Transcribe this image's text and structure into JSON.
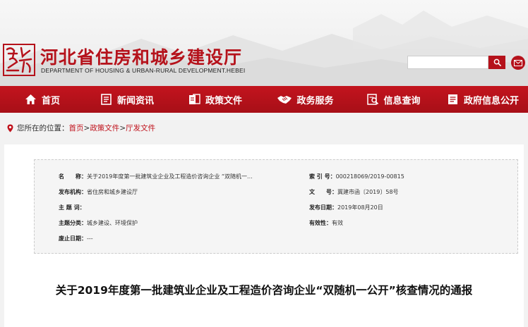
{
  "header": {
    "site_title": "河北省住房和城乡建设厅",
    "site_subtitle": "DEPARTMENT OF HOUSING & URBAN-RURAL DEVELOPMENT.HEBEI",
    "search_value": "",
    "logo_text": "建设厅"
  },
  "nav": {
    "items": [
      {
        "label": "首页",
        "icon": "home-icon"
      },
      {
        "label": "新闻资讯",
        "icon": "news-icon"
      },
      {
        "label": "政策文件",
        "icon": "policy-icon"
      },
      {
        "label": "政务服务",
        "icon": "handshake-icon"
      },
      {
        "label": "信息查询",
        "icon": "search-list-icon"
      },
      {
        "label": "政府信息公开",
        "icon": "document-icon"
      }
    ]
  },
  "breadcrumb": {
    "prefix": "您所在的位置：",
    "items": [
      "首页",
      "政策文件",
      "厅发文件"
    ],
    "separator": ">"
  },
  "info": {
    "name_label": "名　　称：",
    "name_value": "关于2019年度第一批建筑业企业及工程造价咨询企业 “双随机一...",
    "index_label": "索 引 号：",
    "index_value": "000218069/2019-00815",
    "issuer_label": "发布机构：",
    "issuer_value": "省住房和城乡建设厅",
    "docno_label": "文　　号：",
    "docno_value": "冀建市函〔2019〕58号",
    "keywords_label": "主 题 词：",
    "keywords_value": "",
    "date_label": "发布日期：",
    "date_value": "2019年08月20日",
    "category_label": "主题分类：",
    "category_value": "城乡建设、环境保护",
    "validity_label": "有效性：",
    "validity_value": "有效",
    "expiry_label": "废止日期：",
    "expiry_value": "---"
  },
  "article": {
    "title": "关于2019年度第一批建筑业企业及工程造价咨询企业“双随机一公开”核查情况的通报"
  },
  "colors": {
    "brand_red": "#b5121b",
    "link_red": "#c0121c"
  }
}
